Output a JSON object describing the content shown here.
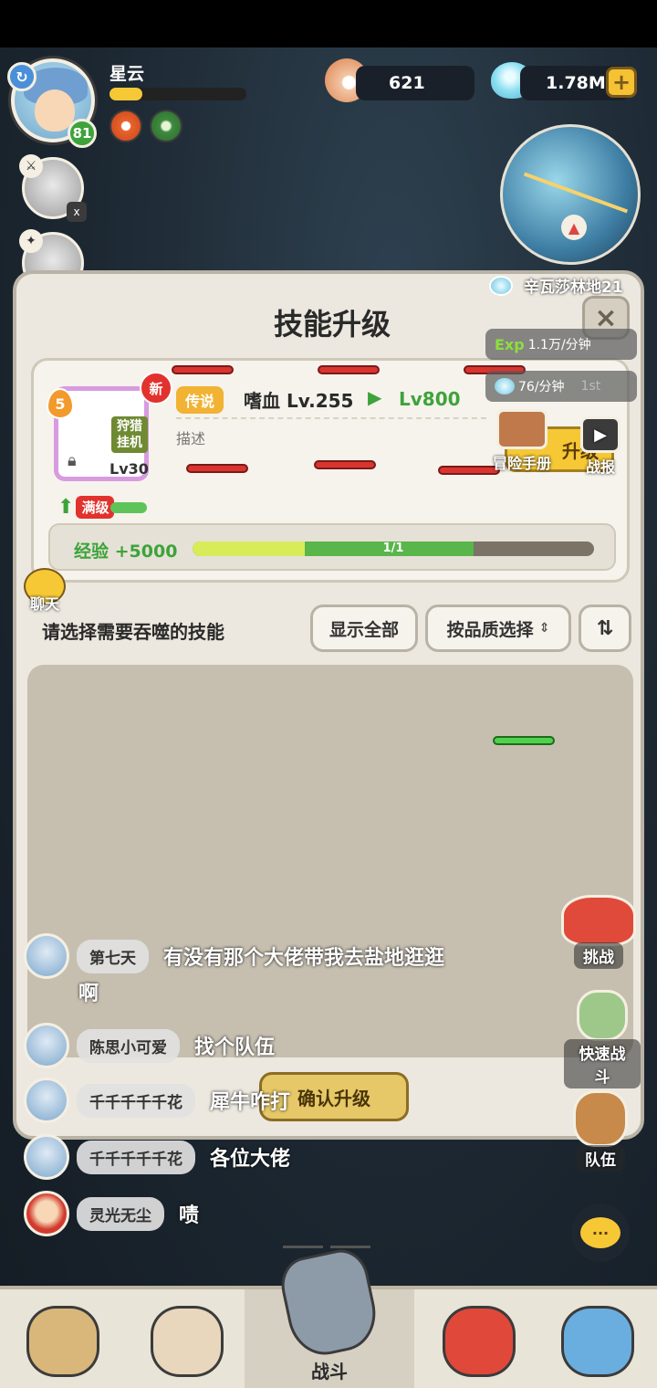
{
  "hud": {
    "player_name": "星云",
    "player_level": "81",
    "pearls": "621",
    "gems": "1.78M",
    "plus": "+",
    "teammate_close": "x"
  },
  "zone": {
    "name": "辛瓦莎林地21",
    "exp_rate": "1.1万/分钟",
    "exp_prefix": "Exp",
    "gem_rate": "76/分钟",
    "rank": "1st"
  },
  "panel": {
    "title": "技能升级",
    "close": "×",
    "skill": {
      "new_badge": "新",
      "stack_count": "5",
      "tag": "狩猎挂机",
      "level_small": "Lv30",
      "max_tag": "满级",
      "rarity": "传说",
      "name": "嗜血 Lv.255",
      "target_level": "Lv800",
      "desc_label": "描述",
      "upgrade_short": "升级"
    },
    "exp": {
      "label": "经验 +5000",
      "progress_text": "1/1",
      "fill_yellow": 0.28,
      "fill_green": 0.42
    },
    "choose_label": "请选择需要吞噬的技能",
    "btn_show_all": "显示全部",
    "btn_quality": "按品质选择",
    "btn_sort": "⇅",
    "confirm": "确认升级"
  },
  "shortcuts": {
    "manual": "冒险手册",
    "battle_report": "战报",
    "chat": "聊天",
    "challenge": "挑战",
    "quick_battle": "快速战斗",
    "team": "队伍"
  },
  "chat": {
    "lines": [
      {
        "name": "第七天",
        "msg": "有没有那个大佬带我去盐地逛逛",
        "cont": "啊"
      },
      {
        "name": "陈思小可爱",
        "msg": "找个队伍"
      },
      {
        "name": "千千千千千花",
        "msg": "犀牛咋打"
      },
      {
        "name": "千千千千千花",
        "msg": "各位大佬"
      },
      {
        "name": "灵光无尘",
        "msg": "啧"
      }
    ],
    "fab": "···"
  },
  "nav": {
    "items": [
      "",
      "",
      "战斗",
      "",
      ""
    ]
  }
}
